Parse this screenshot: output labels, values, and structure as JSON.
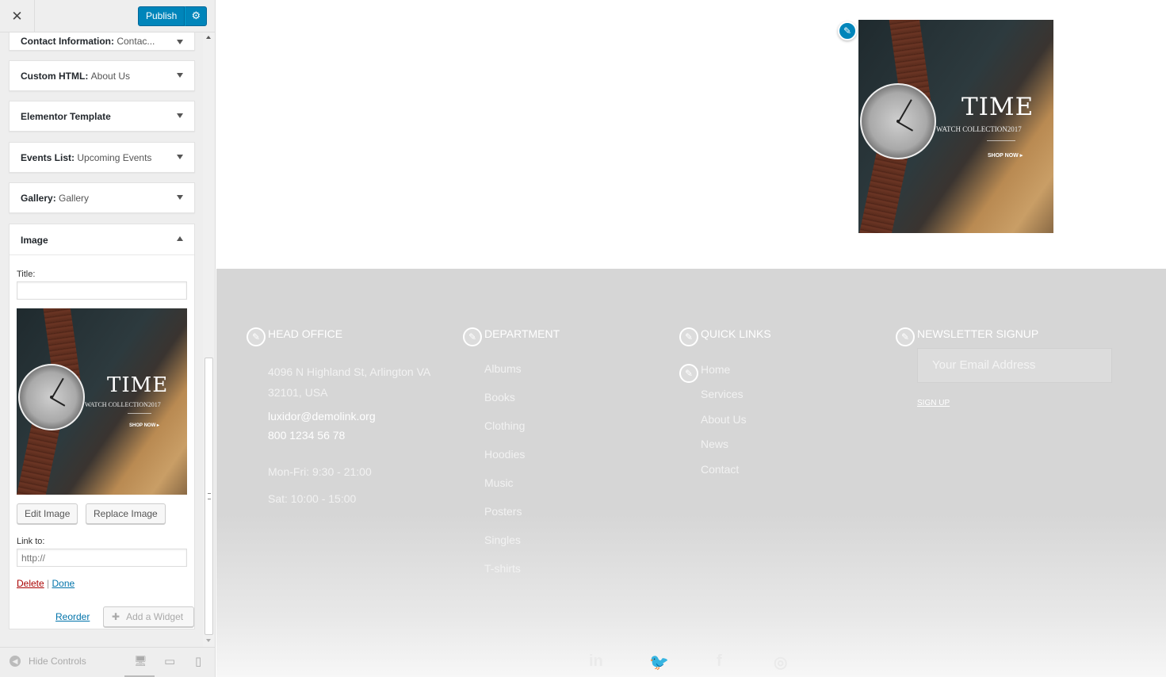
{
  "topbar": {
    "close_label": "✕",
    "publish_label": "Publish",
    "gear_icon": "⚙"
  },
  "widgets": [
    {
      "name": "Contact Information",
      "sub": "Contac..."
    },
    {
      "name": "Custom HTML",
      "sub": "About Us"
    },
    {
      "name": "Elementor Template",
      "sub": ""
    },
    {
      "name": "Events List",
      "sub": "Upcoming Events"
    },
    {
      "name": "Gallery",
      "sub": "Gallery"
    }
  ],
  "image_widget": {
    "title": "Image",
    "title_field_label": "Title:",
    "title_value": "",
    "edit_button": "Edit Image",
    "replace_button": "Replace Image",
    "link_label": "Link to:",
    "link_placeholder": "http://",
    "delete_label": "Delete",
    "separator": "|",
    "done_label": "Done"
  },
  "watch_image": {
    "headline": "TIME",
    "subline": "WATCH COLLECTION2017",
    "cta": "SHOP NOW ▸"
  },
  "panel_footer": {
    "reorder_label": "Reorder",
    "add_widget_label": "Add a Widget",
    "add_icon": "✚"
  },
  "controls": {
    "hide_label": "Hide Controls",
    "hide_icon": "◀",
    "desktop_icon": "🖥",
    "tablet_icon": "▭",
    "mobile_icon": "▯"
  },
  "preview_footer": {
    "head_office": {
      "heading": "HEAD OFFICE",
      "address1": "4096 N Highland St, Arlington VA",
      "address2": "32101, USA",
      "email": "luxidor@demolink.org",
      "phone": "800 1234 56 78",
      "hours1": "Mon-Fri:  9:30 - 21:00",
      "hours2": "Sat:  10:00 - 15:00"
    },
    "department": {
      "heading": "DEPARTMENT",
      "items": [
        "Albums",
        "Books",
        "Clothing",
        "Hoodies",
        "Music",
        "Posters",
        "Singles",
        "T-shirts"
      ]
    },
    "quick_links": {
      "heading": "QUICK LINKS",
      "items": [
        "Home",
        "Services",
        "About Us",
        "News",
        "Contact"
      ]
    },
    "newsletter": {
      "heading": "NEWSLETTER SIGNUP",
      "placeholder": "Your Email Address",
      "signup_label": "SIGN UP"
    },
    "social": [
      "in",
      "🐦",
      "f",
      "◎"
    ]
  },
  "colors": {
    "primary": "#0085ba",
    "delete": "#a00000",
    "link": "#0073aa",
    "footer_bg": "#d6d6d6"
  }
}
